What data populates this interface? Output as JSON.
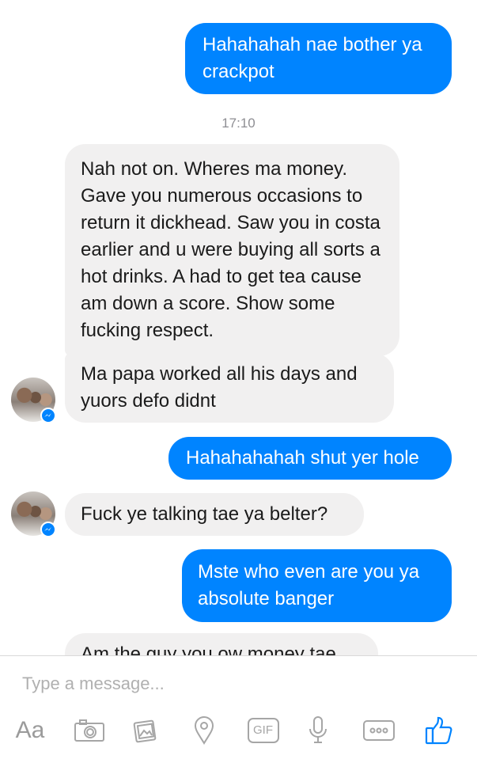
{
  "messages": [
    {
      "direction": "outgoing",
      "text": "Hahahahah nae bother ya crackpot"
    },
    {
      "direction": "incoming",
      "text": "Nah not on. Wheres ma money. Gave you numerous occasions to return it dickhead. Saw you in costa earlier and u were buying all sorts a hot drinks. A had to get tea cause am down a score. Show some fucking respect."
    },
    {
      "direction": "incoming",
      "text": "Ma papa worked all his days and yuors defo didnt"
    },
    {
      "direction": "outgoing",
      "text": "Hahahahahah shut yer hole"
    },
    {
      "direction": "incoming",
      "text": "Fuck ye talking tae ya belter?"
    },
    {
      "direction": "outgoing",
      "text": "Mste who even are you ya absolute banger"
    },
    {
      "direction": "incoming",
      "text": "Am the guy you ow money tae"
    }
  ],
  "timestamp": "17:10",
  "composer": {
    "placeholder": "Type a message...",
    "aa_label": "Aa",
    "gif_label": "GIF"
  },
  "colors": {
    "outgoing_bubble": "#0084ff",
    "incoming_bubble": "#f1f0f0",
    "icon": "#a6a6a6",
    "like": "#0084ff"
  },
  "icons": [
    "camera-icon",
    "photo-icon",
    "location-icon",
    "gif-icon",
    "microphone-icon",
    "more-icon",
    "thumbs-up-icon"
  ]
}
